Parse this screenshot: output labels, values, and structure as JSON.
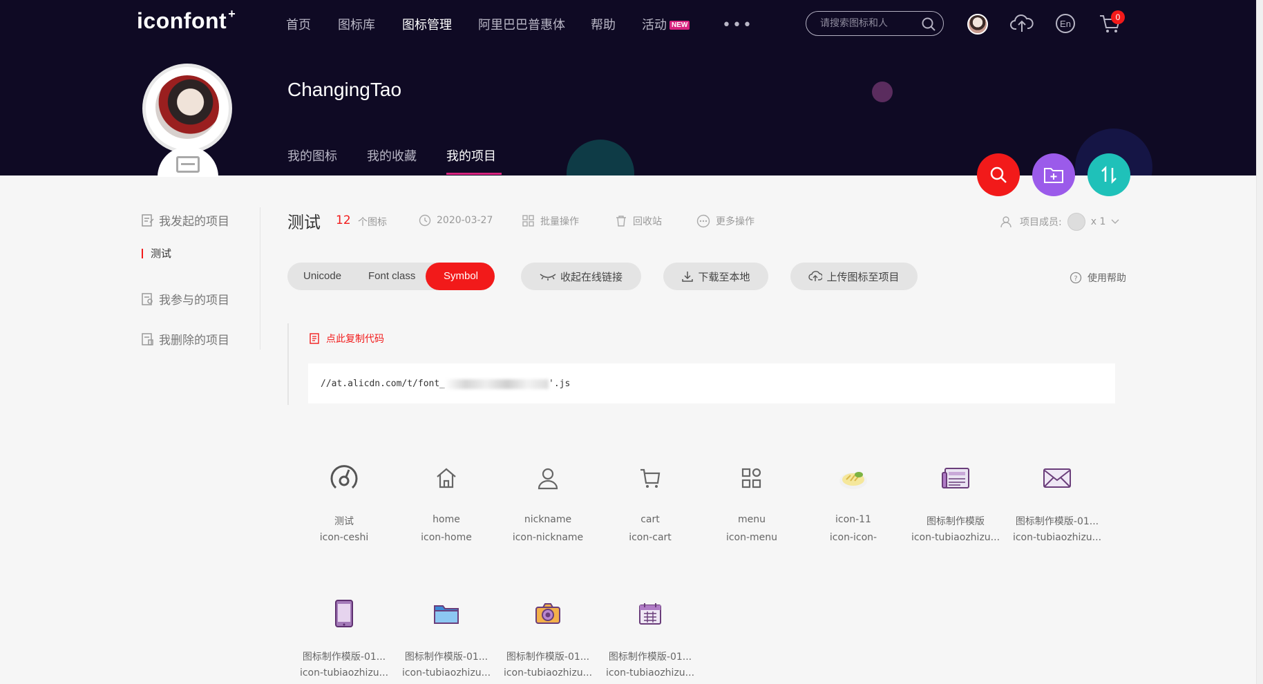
{
  "header": {
    "logo": "iconfont",
    "logo_mark": "+",
    "nav": [
      {
        "label": "首页"
      },
      {
        "label": "图标库"
      },
      {
        "label": "图标管理"
      },
      {
        "label": "阿里巴巴普惠体"
      },
      {
        "label": "帮助"
      },
      {
        "label": "活动",
        "badge": "NEW"
      }
    ],
    "more": "•••",
    "search_placeholder": "请搜索图标和人",
    "cart_count": "0"
  },
  "profile": {
    "username": "ChangingTao",
    "tabs": [
      "我的图标",
      "我的收藏",
      "我的项目"
    ]
  },
  "sidebar": {
    "items": [
      "我发起的项目",
      "我参与的项目",
      "我删除的项目"
    ],
    "sub_item": "测试"
  },
  "project": {
    "title": "测试",
    "count": "12",
    "count_label": "个图标",
    "date": "2020-03-27",
    "batch": "批量操作",
    "trash": "回收站",
    "more_ops": "更多操作",
    "members_label": "项目成员:",
    "members_count": "x 1",
    "code_types": [
      "Unicode",
      "Font class",
      "Symbol"
    ],
    "collapse_link": "收起在线链接",
    "download": "下载至本地",
    "upload": "上传图标至项目",
    "help": "使用帮助",
    "copy_code": "点此复制代码",
    "url_prefix": "//at.alicdn.com/t/font_",
    "url_suffix": "'.js"
  },
  "icons": [
    {
      "name": "测试",
      "code": "icon-ceshi",
      "glyph": "ceshi-icon"
    },
    {
      "name": "home",
      "code": "icon-home",
      "glyph": "home-icon"
    },
    {
      "name": "nickname",
      "code": "icon-nickname",
      "glyph": "user-icon"
    },
    {
      "name": "cart",
      "code": "icon-cart",
      "glyph": "cart-icon"
    },
    {
      "name": "menu",
      "code": "icon-menu",
      "glyph": "grid-menu-icon"
    },
    {
      "name": "icon-11",
      "code": "icon-icon-",
      "glyph": "sushi-icon"
    },
    {
      "name": "图标制作模版",
      "code": "icon-tubiaozhizu...",
      "glyph": "newspaper-icon"
    },
    {
      "name": "图标制作模版-01...",
      "code": "icon-tubiaozhizu...",
      "glyph": "envelope-icon"
    },
    {
      "name": "图标制作模版-01...",
      "code": "icon-tubiaozhizu...",
      "glyph": "phone-icon"
    },
    {
      "name": "图标制作模版-01...",
      "code": "icon-tubiaozhizu...",
      "glyph": "folder-icon"
    },
    {
      "name": "图标制作模版-01...",
      "code": "icon-tubiaozhizu...",
      "glyph": "camera-icon"
    },
    {
      "name": "图标制作模版-01...",
      "code": "icon-tubiaozhizu...",
      "glyph": "calendar-icon"
    }
  ],
  "colors": {
    "header_bg": "#0f0a24",
    "accent_red": "#f21a1a",
    "fab_purple": "#9b5bea",
    "fab_teal": "#1fc1b9",
    "page_bg": "#f6f6f6"
  }
}
